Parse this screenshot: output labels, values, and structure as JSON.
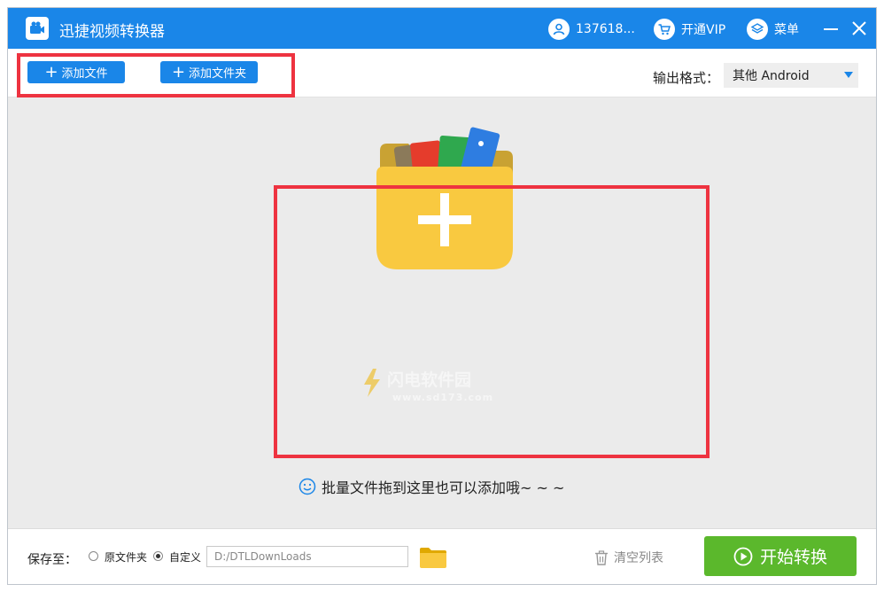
{
  "app": {
    "title": "迅捷视频转换器"
  },
  "titlebar": {
    "user_label": "137618...",
    "vip_label": "开通VIP",
    "menu_label": "菜单"
  },
  "toolbar": {
    "add_file_label": "添加文件",
    "add_folder_label": "添加文件夹",
    "output_format_label": "输出格式：",
    "output_format_value": "其他  Android"
  },
  "drop_zone": {
    "hint": "批量文件拖到这里也可以添加哦~ ~ ~",
    "watermark_title": "闪电软件园",
    "watermark_url": "www.sd173.com"
  },
  "footer": {
    "save_to_label": "保存至：",
    "option_original": "原文件夹",
    "option_custom": "自定义",
    "selected_option": "custom",
    "path_value": "D:/DTLDownLoads",
    "clear_list_label": "清空列表",
    "start_label": "开始转换"
  },
  "colors": {
    "accent": "#1a86e8",
    "start_green": "#5bb82c",
    "highlight_red": "#ee3340",
    "folder_yellow": "#f9c940"
  }
}
